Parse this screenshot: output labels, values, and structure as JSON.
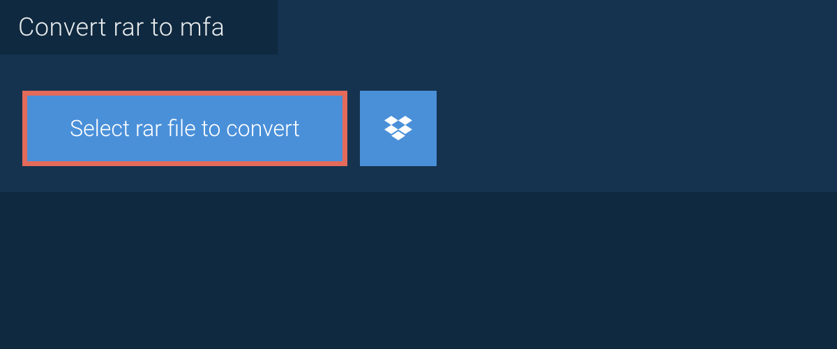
{
  "header": {
    "title": "Convert rar to mfa"
  },
  "actions": {
    "select_file_label": "Select rar file to convert",
    "dropbox_icon": "dropbox-icon"
  },
  "colors": {
    "page_bg": "#0f2940",
    "panel_bg": "#15334f",
    "button_bg": "#4a90d9",
    "highlight_border": "#e46a5a",
    "text_light": "#e8ebec"
  }
}
